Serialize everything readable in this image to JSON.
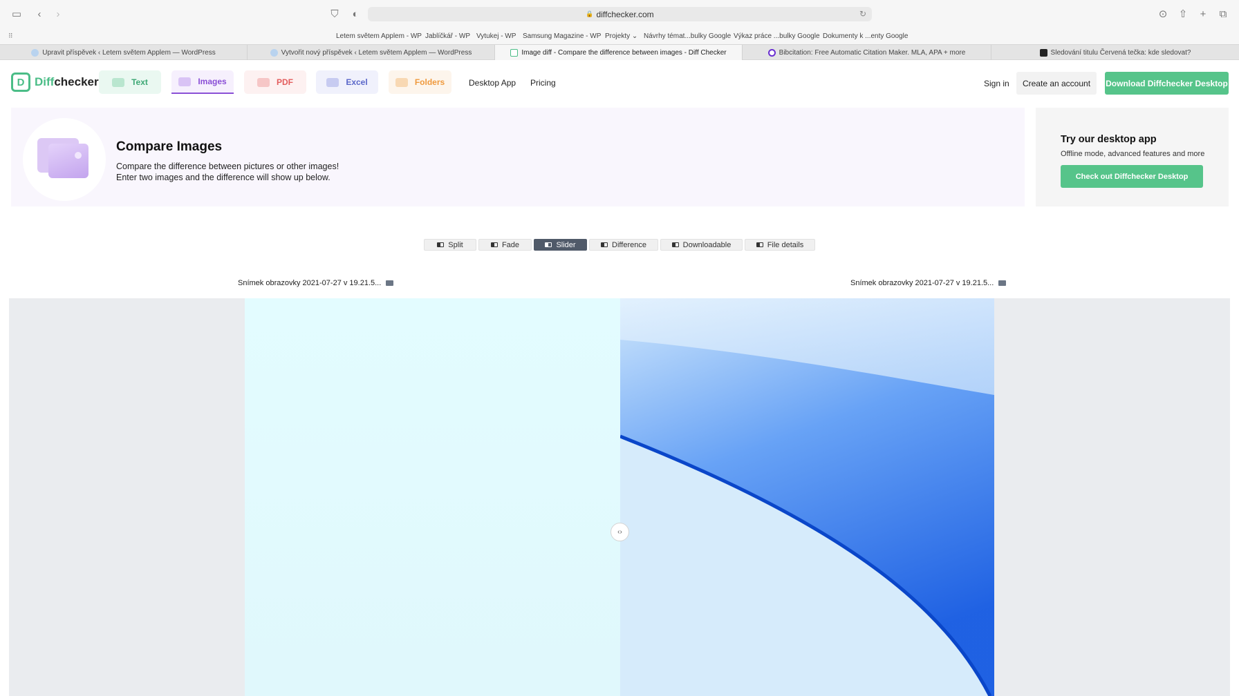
{
  "browser": {
    "url": "diffchecker.com",
    "favorites": [
      "Letem světem Applem - WP",
      "Jablíčkář - WP",
      "Vytukej - WP",
      "Samsung Magazine - WP",
      "Projekty",
      "Návrhy témat...bulky Google",
      "Výkaz práce ...bulky Google",
      "Dokumenty k ...enty Google"
    ],
    "tabs": [
      "Upravit příspěvek ‹ Letem světem Applem — WordPress",
      "Vytvořit nový příspěvek ‹ Letem světem Applem — WordPress",
      "Image diff - Compare the difference between images - Diff Checker",
      "Bibcitation: Free Automatic Citation Maker. MLA, APA + more",
      "Sledování titulu Červená tečka: kde sledovat?"
    ]
  },
  "header": {
    "logo_prefix": "Diff",
    "logo_suffix": "checker",
    "nav_tabs": [
      "Text",
      "Images",
      "PDF",
      "Excel",
      "Folders"
    ],
    "links": [
      "Desktop App",
      "Pricing"
    ],
    "sign_in": "Sign in",
    "create_account": "Create an account",
    "download": "Download Diffchecker Desktop"
  },
  "hero": {
    "title": "Compare Images",
    "desc_line1": "Compare the difference between pictures or other images!",
    "desc_line2": "Enter two images and the difference will show up below."
  },
  "promo": {
    "title": "Try our desktop app",
    "subtitle": "Offline mode, advanced features and more",
    "button": "Check out Diffchecker Desktop"
  },
  "modes": {
    "items": [
      "Split",
      "Fade",
      "Slider",
      "Difference",
      "Downloadable",
      "File details"
    ],
    "active": "Slider"
  },
  "files": {
    "left": "Snímek obrazovky 2021-07-27 v 19.21.5...",
    "right": "Snímek obrazovky 2021-07-27 v 19.21.5..."
  },
  "slider": {
    "handle_glyph": "‹›"
  },
  "colors": {
    "brand_green": "#56c48a",
    "images_purple": "#8a4fd6",
    "active_mode": "#505a69"
  }
}
